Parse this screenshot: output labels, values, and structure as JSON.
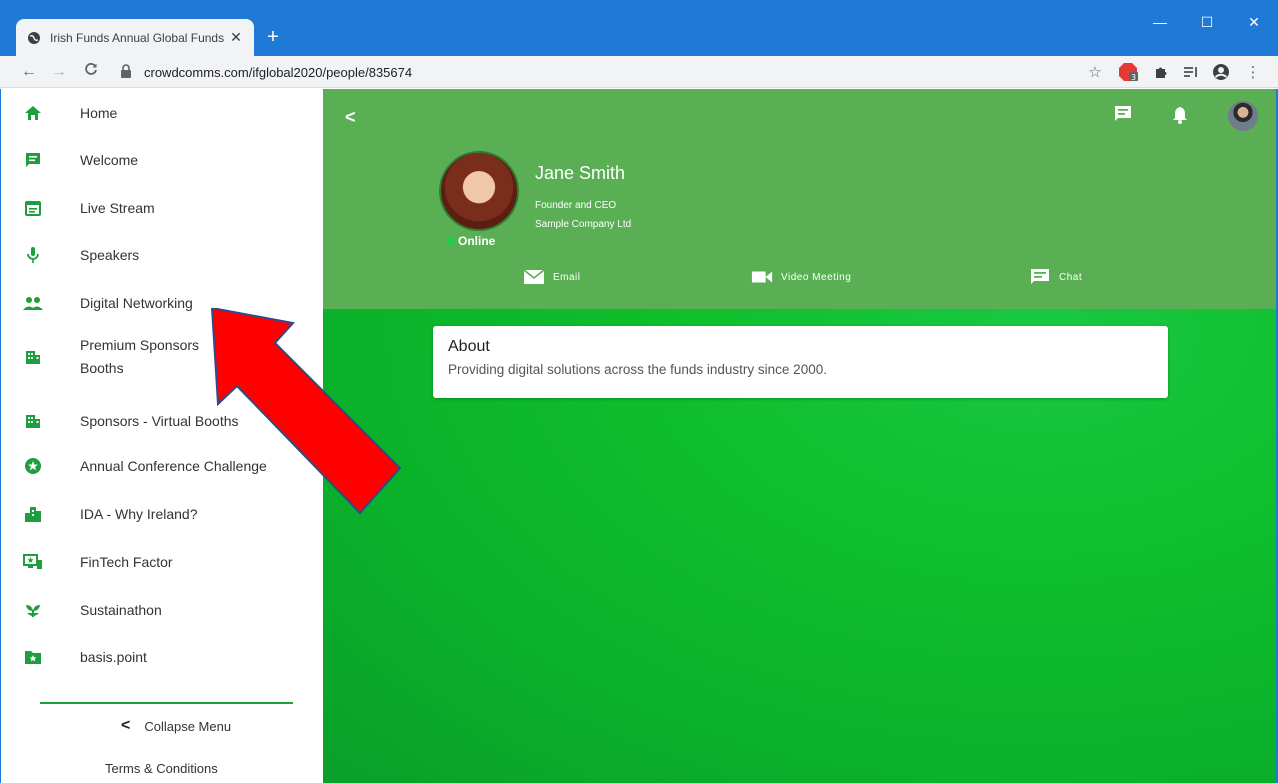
{
  "browser": {
    "tab_title": "Irish Funds Annual Global Funds",
    "tab_close": "✕",
    "new_tab": "+",
    "url": "crowdcomms.com/ifglobal2020/people/835674",
    "window_min": "—",
    "window_max": "☐",
    "window_close": "✕",
    "ext_badge": "3"
  },
  "sidebar": {
    "items": [
      {
        "label": "Home",
        "icon": "home-icon"
      },
      {
        "label": "Welcome",
        "icon": "message-icon"
      },
      {
        "label": "Live Stream",
        "icon": "calendar-icon"
      },
      {
        "label": "Speakers",
        "icon": "microphone-icon"
      },
      {
        "label": "Digital Networking",
        "icon": "people-icon"
      },
      {
        "label": "Premium Sponsors",
        "label2": "Booths",
        "icon": "building-icon"
      },
      {
        "label": "Sponsors - Virtual Booths",
        "icon": "building-icon"
      },
      {
        "label": "Annual Conference Challenge",
        "icon": "star-circle-icon"
      },
      {
        "label": "IDA - Why Ireland?",
        "icon": "city-icon"
      },
      {
        "label": "FinTech Factor",
        "icon": "devices-icon"
      },
      {
        "label": "Sustainathon",
        "icon": "sprout-icon"
      },
      {
        "label": "basis.point",
        "icon": "folder-star-icon"
      }
    ],
    "collapse_label": "Collapse Menu",
    "terms_label": "Terms & Conditions"
  },
  "profile": {
    "name": "Jane Smith",
    "title": "Founder and CEO",
    "company": "Sample Company Ltd",
    "status": "Online",
    "actions": {
      "email": "Email",
      "video": "Video Meeting",
      "chat": "Chat"
    }
  },
  "about": {
    "heading": "About",
    "text": "Providing digital solutions across the funds industry since 2000."
  },
  "colors": {
    "accent_green": "#1e9e3e",
    "header_green": "#5aaf55",
    "chrome_blue": "#1f7ad6",
    "arrow_red": "#ff0000"
  }
}
